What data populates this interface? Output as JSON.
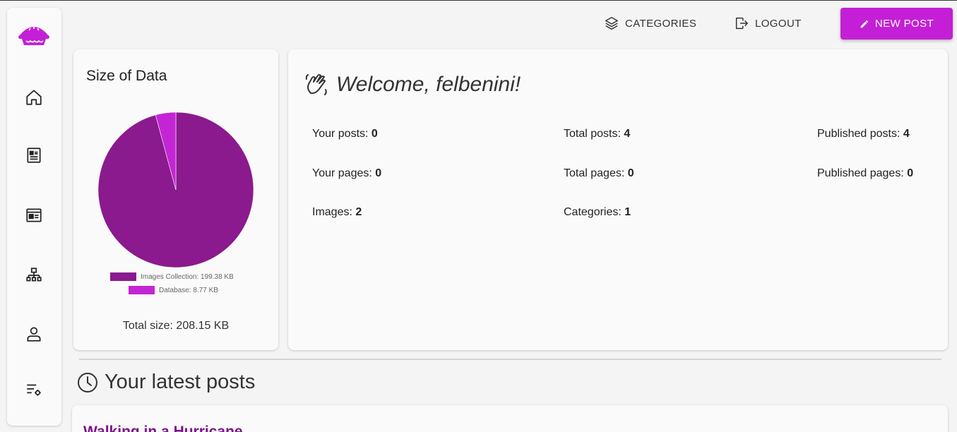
{
  "topbar": {
    "categories_label": "CATEGORIES",
    "logout_label": "LOGOUT",
    "new_post_label": "NEW POST"
  },
  "sidebar": {
    "items": [
      {
        "name": "home",
        "icon": "home-icon"
      },
      {
        "name": "posts",
        "icon": "article-icon"
      },
      {
        "name": "pages",
        "icon": "page-icon"
      },
      {
        "name": "categories",
        "icon": "sitemap-icon"
      },
      {
        "name": "profile",
        "icon": "user-icon"
      },
      {
        "name": "settings",
        "icon": "settings-list-icon"
      }
    ]
  },
  "size_card": {
    "title": "Size of Data",
    "total_size": "Total size: 208.15 KB"
  },
  "chart_data": {
    "type": "pie",
    "title": "",
    "slices": [
      {
        "label": "Images Collection: 199.38 KB",
        "value": 199.38,
        "color": "#8a1a8e"
      },
      {
        "label": "Database: 8.77 KB",
        "value": 8.77,
        "color": "#c425d4"
      }
    ]
  },
  "welcome": {
    "title": "Welcome, felbenini!",
    "stats": {
      "your_posts": {
        "label": "Your posts:",
        "value": "0"
      },
      "total_posts": {
        "label": "Total posts:",
        "value": "4"
      },
      "published_posts": {
        "label": "Published posts:",
        "value": "4"
      },
      "your_pages": {
        "label": "Your pages:",
        "value": "0"
      },
      "total_pages": {
        "label": "Total pages:",
        "value": "0"
      },
      "published_pages": {
        "label": "Published pages:",
        "value": "0"
      },
      "images": {
        "label": "Images:",
        "value": "2"
      },
      "categories": {
        "label": "Categories:",
        "value": "1"
      }
    }
  },
  "latest": {
    "title": "Your latest posts",
    "posts": [
      {
        "title": "Walking in a Hurricane"
      }
    ]
  },
  "colors": {
    "accent": "#c41fd6",
    "post_title": "#7b1488"
  }
}
